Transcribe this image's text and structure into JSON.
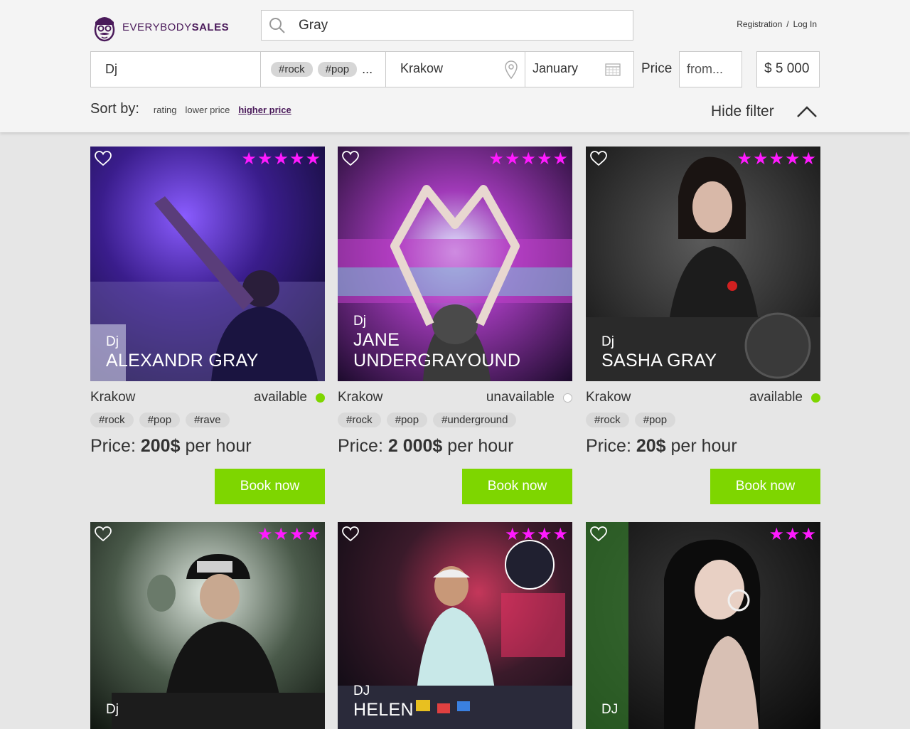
{
  "brand": {
    "name_light": "EVERYBODY",
    "name_bold": "SALES"
  },
  "search": {
    "value": "Gray"
  },
  "auth": {
    "register": "Registration",
    "separator": "/",
    "login": "Log In"
  },
  "filters": {
    "type": "Dj",
    "tags": [
      "#rock",
      "#pop"
    ],
    "tags_more": "...",
    "city": "Krakow",
    "month": "January",
    "price_label": "Price",
    "price_from_placeholder": "from...",
    "price_to": "$ 5 000"
  },
  "sort": {
    "label": "Sort by:",
    "options": [
      "rating",
      "lower price",
      "higher price"
    ],
    "active": "higher price"
  },
  "hide_filter": "Hide filter",
  "cards": [
    {
      "type": "Dj",
      "name": "Alexandr Gray",
      "city": "Krakow",
      "status": "available",
      "available": true,
      "tags": [
        "#rock",
        "#pop",
        "#rave"
      ],
      "price_prefix": "Price:",
      "price": "200$",
      "price_suffix": "per hour",
      "rating": 5,
      "book": "Book now"
    },
    {
      "type": "Dj",
      "name": "Jane Undergrayound",
      "city": "Krakow",
      "status": "unavailable",
      "available": false,
      "tags": [
        "#rock",
        "#pop",
        "#underground"
      ],
      "price_prefix": "Price:",
      "price": "2 000$",
      "price_suffix": "per hour",
      "rating": 5,
      "book": "Book now"
    },
    {
      "type": "Dj",
      "name": "Sasha Gray",
      "city": "Krakow",
      "status": "available",
      "available": true,
      "tags": [
        "#rock",
        "#pop"
      ],
      "price_prefix": "Price:",
      "price": "20$",
      "price_suffix": "per hour",
      "rating": 5,
      "book": "Book now"
    },
    {
      "type": "Dj",
      "name": "",
      "rating": 4
    },
    {
      "type": "DJ",
      "name": "Helen",
      "rating": 4
    },
    {
      "type": "DJ",
      "name": "",
      "rating": 3
    }
  ],
  "colors": {
    "accent": "#7ed600",
    "star": "#ff1aff",
    "brand": "#4a1a5a"
  }
}
